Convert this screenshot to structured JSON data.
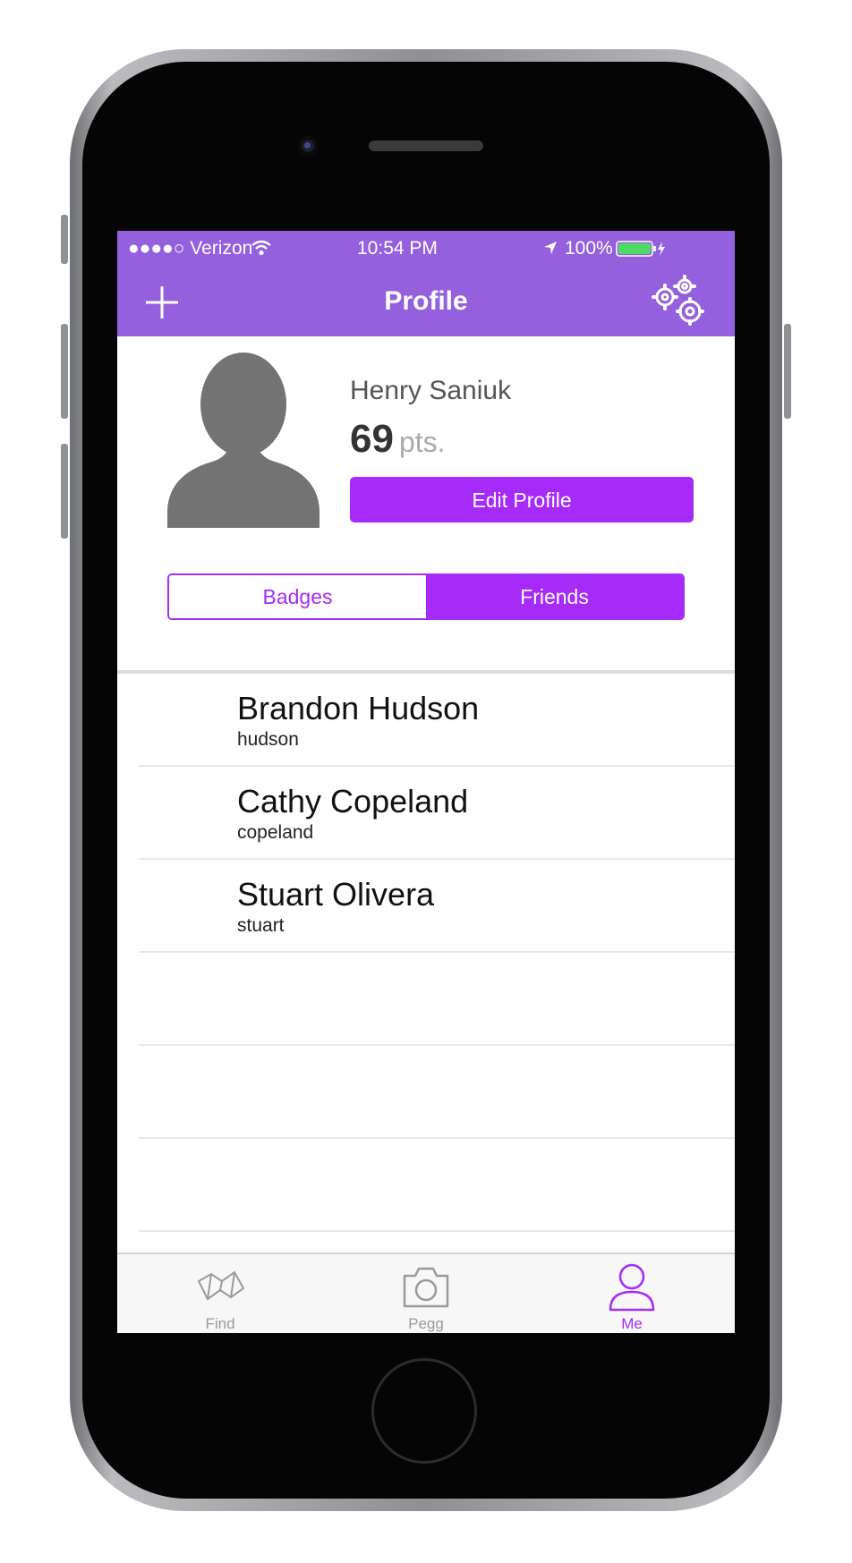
{
  "status_bar": {
    "carrier": "●●●●○ Verizon",
    "wifi_icon": "wifi-icon",
    "time": "10:54 PM",
    "location_icon": "location-arrow-icon",
    "battery": "100%"
  },
  "nav": {
    "title": "Profile",
    "left_icon": "plus-icon",
    "right_icon": "gears-icon"
  },
  "profile": {
    "name": "Henry Saniuk",
    "points": "69",
    "points_unit": "pts.",
    "edit_label": "Edit Profile"
  },
  "segments": [
    {
      "label": "Badges",
      "selected": false
    },
    {
      "label": "Friends",
      "selected": true
    }
  ],
  "friends": [
    {
      "name": "Brandon Hudson",
      "handle": "hudson"
    },
    {
      "name": "Cathy Copeland",
      "handle": "copeland"
    },
    {
      "name": "Stuart Olivera",
      "handle": "stuart"
    },
    {
      "name": "",
      "handle": ""
    },
    {
      "name": "",
      "handle": ""
    },
    {
      "name": "",
      "handle": ""
    }
  ],
  "tabs": [
    {
      "label": "Find",
      "icon": "map-icon",
      "active": false
    },
    {
      "label": "Pegg",
      "icon": "camera-icon",
      "active": false
    },
    {
      "label": "Me",
      "icon": "person-icon",
      "active": true
    }
  ],
  "colors": {
    "header": "#9460de",
    "accent": "#a62af8",
    "tab_inactive": "#9a9a9a"
  }
}
